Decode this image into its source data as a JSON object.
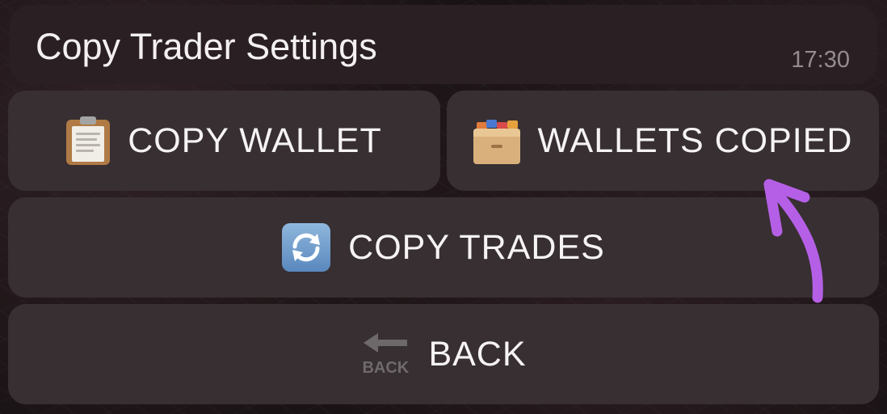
{
  "message": {
    "title": "Copy Trader Settings",
    "time": "17:30"
  },
  "keyboard": {
    "copy_wallet": {
      "label": "COPY WALLET",
      "icon": "clipboard-icon"
    },
    "wallets_copied": {
      "label": "WALLETS COPIED",
      "icon": "card-file-box-icon"
    },
    "copy_trades": {
      "label": "COPY TRADES",
      "icon": "refresh-icon"
    },
    "back": {
      "label": "BACK",
      "icon": "back-arrow-icon",
      "icon_text": "BACK"
    }
  },
  "annotation": {
    "color": "#b55fe6",
    "icon": "curved-arrow-annotation"
  }
}
